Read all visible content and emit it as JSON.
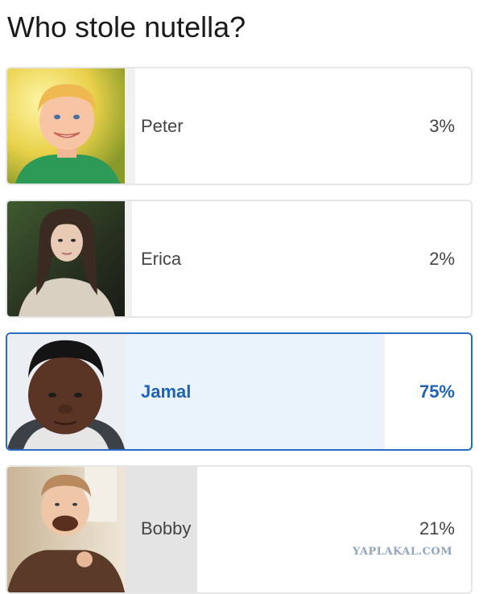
{
  "poll": {
    "question": "Who stole nutella?",
    "options": [
      {
        "label": "Peter",
        "percent_text": "3%",
        "percent": 3,
        "selected": false
      },
      {
        "label": "Erica",
        "percent_text": "2%",
        "percent": 2,
        "selected": false
      },
      {
        "label": "Jamal",
        "percent_text": "75%",
        "percent": 75,
        "selected": true
      },
      {
        "label": "Bobby",
        "percent_text": "21%",
        "percent": 21,
        "selected": false
      }
    ]
  },
  "watermark": "YAPLAKAL.COM",
  "colors": {
    "selected_border": "#2a6cc4",
    "selected_text": "#1f63b8",
    "selected_fill": "#eaf3fc",
    "default_fill": "#f1f1f1",
    "card_border": "#e6e6e6"
  }
}
